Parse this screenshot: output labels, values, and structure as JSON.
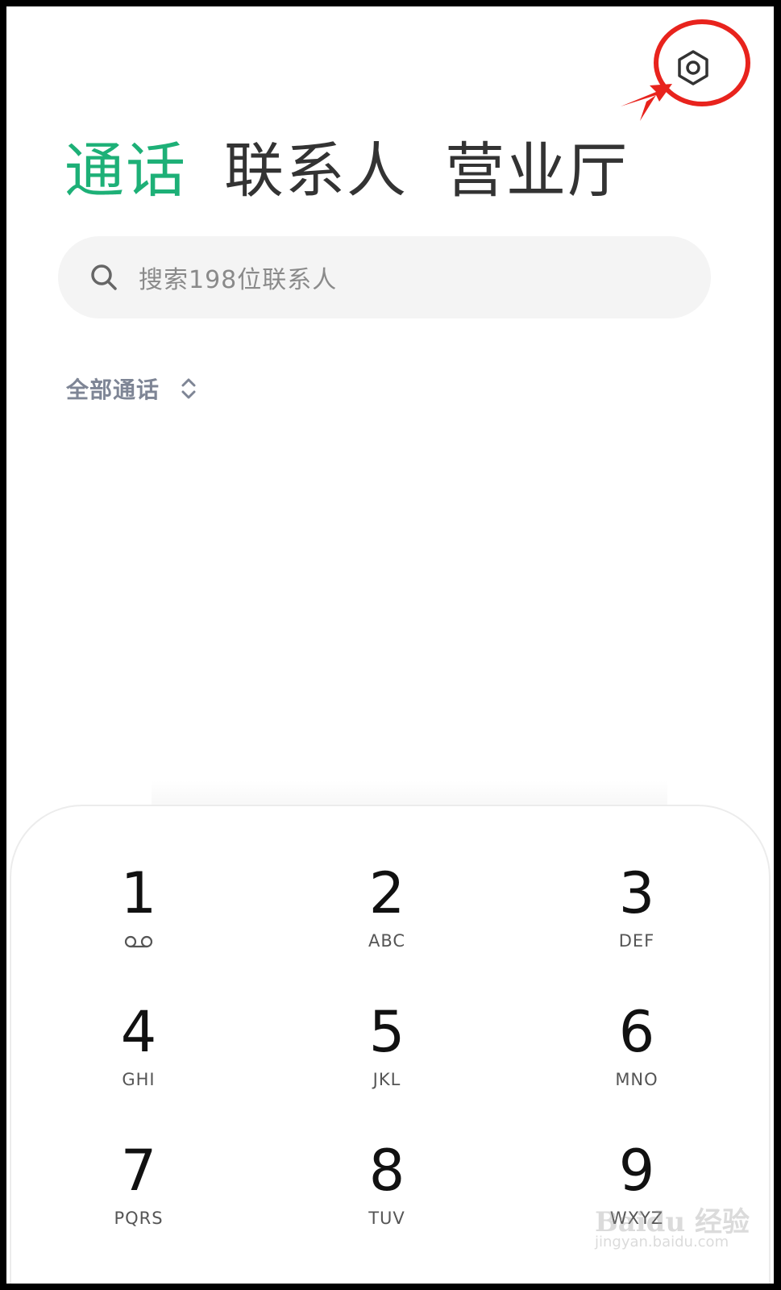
{
  "tabs": [
    {
      "label": "通话",
      "active": true
    },
    {
      "label": "联系人",
      "active": false
    },
    {
      "label": "营业厅",
      "active": false
    }
  ],
  "search": {
    "placeholder": "搜索198位联系人",
    "icon": "search-icon"
  },
  "filter": {
    "label": "全部通话",
    "icon": "chevron-up-down-icon"
  },
  "settings": {
    "icon": "settings-icon",
    "annotation_color": "#e8231d"
  },
  "accent_color": "#1db077",
  "keypad": {
    "keys": [
      {
        "digit": "1",
        "letters": "",
        "icon": "voicemail-icon"
      },
      {
        "digit": "2",
        "letters": "ABC"
      },
      {
        "digit": "3",
        "letters": "DEF"
      },
      {
        "digit": "4",
        "letters": "GHI"
      },
      {
        "digit": "5",
        "letters": "JKL"
      },
      {
        "digit": "6",
        "letters": "MNO"
      },
      {
        "digit": "7",
        "letters": "PQRS"
      },
      {
        "digit": "8",
        "letters": "TUV"
      },
      {
        "digit": "9",
        "letters": "WXYZ"
      }
    ]
  },
  "watermark": {
    "brand": "Baidu 经验",
    "url": "jingyan.baidu.com"
  }
}
